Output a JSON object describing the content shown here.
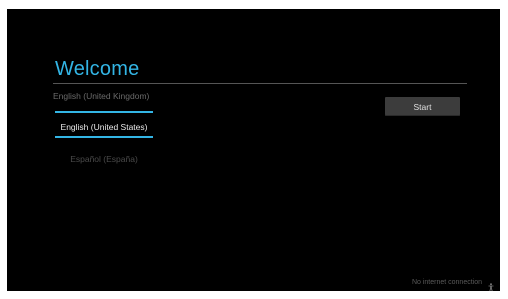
{
  "welcome": {
    "title": "Welcome"
  },
  "language_picker": {
    "items": [
      {
        "label": "English (United Kingdom)",
        "state": "above"
      },
      {
        "label": "English (United States)",
        "state": "selected"
      },
      {
        "label": "Español (España)",
        "state": "below"
      }
    ]
  },
  "start_button": {
    "label": "Start"
  },
  "status": {
    "connection_text": "No internet connection",
    "icon": "accessibility-icon"
  },
  "colors": {
    "accent": "#33b5e5",
    "background": "#000000",
    "button": "#3c3c3c"
  }
}
